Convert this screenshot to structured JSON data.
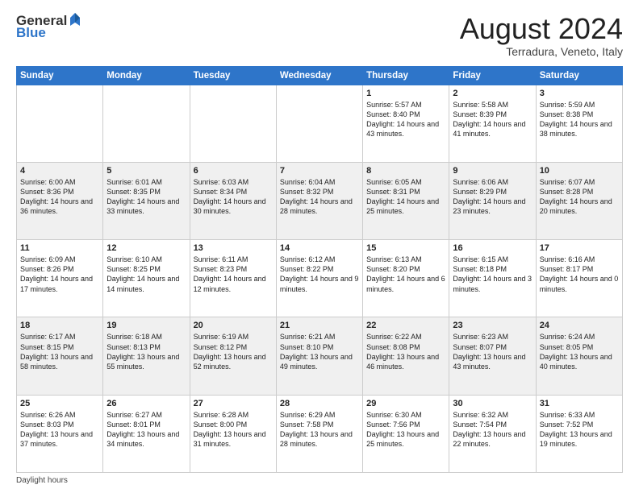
{
  "logo": {
    "general": "General",
    "blue": "Blue"
  },
  "header": {
    "month_year": "August 2024",
    "location": "Terradura, Veneto, Italy"
  },
  "days_of_week": [
    "Sunday",
    "Monday",
    "Tuesday",
    "Wednesday",
    "Thursday",
    "Friday",
    "Saturday"
  ],
  "weeks": [
    [
      {
        "day": "",
        "info": ""
      },
      {
        "day": "",
        "info": ""
      },
      {
        "day": "",
        "info": ""
      },
      {
        "day": "",
        "info": ""
      },
      {
        "day": "1",
        "info": "Sunrise: 5:57 AM\nSunset: 8:40 PM\nDaylight: 14 hours and 43 minutes."
      },
      {
        "day": "2",
        "info": "Sunrise: 5:58 AM\nSunset: 8:39 PM\nDaylight: 14 hours and 41 minutes."
      },
      {
        "day": "3",
        "info": "Sunrise: 5:59 AM\nSunset: 8:38 PM\nDaylight: 14 hours and 38 minutes."
      }
    ],
    [
      {
        "day": "4",
        "info": "Sunrise: 6:00 AM\nSunset: 8:36 PM\nDaylight: 14 hours and 36 minutes."
      },
      {
        "day": "5",
        "info": "Sunrise: 6:01 AM\nSunset: 8:35 PM\nDaylight: 14 hours and 33 minutes."
      },
      {
        "day": "6",
        "info": "Sunrise: 6:03 AM\nSunset: 8:34 PM\nDaylight: 14 hours and 30 minutes."
      },
      {
        "day": "7",
        "info": "Sunrise: 6:04 AM\nSunset: 8:32 PM\nDaylight: 14 hours and 28 minutes."
      },
      {
        "day": "8",
        "info": "Sunrise: 6:05 AM\nSunset: 8:31 PM\nDaylight: 14 hours and 25 minutes."
      },
      {
        "day": "9",
        "info": "Sunrise: 6:06 AM\nSunset: 8:29 PM\nDaylight: 14 hours and 23 minutes."
      },
      {
        "day": "10",
        "info": "Sunrise: 6:07 AM\nSunset: 8:28 PM\nDaylight: 14 hours and 20 minutes."
      }
    ],
    [
      {
        "day": "11",
        "info": "Sunrise: 6:09 AM\nSunset: 8:26 PM\nDaylight: 14 hours and 17 minutes."
      },
      {
        "day": "12",
        "info": "Sunrise: 6:10 AM\nSunset: 8:25 PM\nDaylight: 14 hours and 14 minutes."
      },
      {
        "day": "13",
        "info": "Sunrise: 6:11 AM\nSunset: 8:23 PM\nDaylight: 14 hours and 12 minutes."
      },
      {
        "day": "14",
        "info": "Sunrise: 6:12 AM\nSunset: 8:22 PM\nDaylight: 14 hours and 9 minutes."
      },
      {
        "day": "15",
        "info": "Sunrise: 6:13 AM\nSunset: 8:20 PM\nDaylight: 14 hours and 6 minutes."
      },
      {
        "day": "16",
        "info": "Sunrise: 6:15 AM\nSunset: 8:18 PM\nDaylight: 14 hours and 3 minutes."
      },
      {
        "day": "17",
        "info": "Sunrise: 6:16 AM\nSunset: 8:17 PM\nDaylight: 14 hours and 0 minutes."
      }
    ],
    [
      {
        "day": "18",
        "info": "Sunrise: 6:17 AM\nSunset: 8:15 PM\nDaylight: 13 hours and 58 minutes."
      },
      {
        "day": "19",
        "info": "Sunrise: 6:18 AM\nSunset: 8:13 PM\nDaylight: 13 hours and 55 minutes."
      },
      {
        "day": "20",
        "info": "Sunrise: 6:19 AM\nSunset: 8:12 PM\nDaylight: 13 hours and 52 minutes."
      },
      {
        "day": "21",
        "info": "Sunrise: 6:21 AM\nSunset: 8:10 PM\nDaylight: 13 hours and 49 minutes."
      },
      {
        "day": "22",
        "info": "Sunrise: 6:22 AM\nSunset: 8:08 PM\nDaylight: 13 hours and 46 minutes."
      },
      {
        "day": "23",
        "info": "Sunrise: 6:23 AM\nSunset: 8:07 PM\nDaylight: 13 hours and 43 minutes."
      },
      {
        "day": "24",
        "info": "Sunrise: 6:24 AM\nSunset: 8:05 PM\nDaylight: 13 hours and 40 minutes."
      }
    ],
    [
      {
        "day": "25",
        "info": "Sunrise: 6:26 AM\nSunset: 8:03 PM\nDaylight: 13 hours and 37 minutes."
      },
      {
        "day": "26",
        "info": "Sunrise: 6:27 AM\nSunset: 8:01 PM\nDaylight: 13 hours and 34 minutes."
      },
      {
        "day": "27",
        "info": "Sunrise: 6:28 AM\nSunset: 8:00 PM\nDaylight: 13 hours and 31 minutes."
      },
      {
        "day": "28",
        "info": "Sunrise: 6:29 AM\nSunset: 7:58 PM\nDaylight: 13 hours and 28 minutes."
      },
      {
        "day": "29",
        "info": "Sunrise: 6:30 AM\nSunset: 7:56 PM\nDaylight: 13 hours and 25 minutes."
      },
      {
        "day": "30",
        "info": "Sunrise: 6:32 AM\nSunset: 7:54 PM\nDaylight: 13 hours and 22 minutes."
      },
      {
        "day": "31",
        "info": "Sunrise: 6:33 AM\nSunset: 7:52 PM\nDaylight: 13 hours and 19 minutes."
      }
    ]
  ],
  "footer": {
    "daylight_label": "Daylight hours"
  }
}
